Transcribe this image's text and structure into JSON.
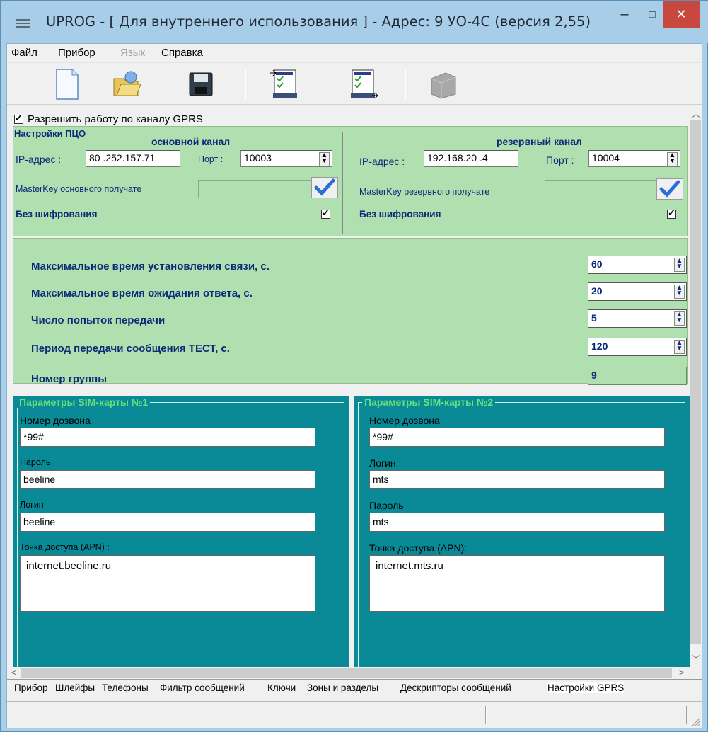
{
  "window": {
    "title": "UPROG - [ Для внутреннего использования ] - Адрес:  9  УО-4С (версия  2,55)",
    "min_glyph": "–",
    "max_glyph": "□",
    "close_glyph": "✕"
  },
  "menu": {
    "file": "Файл",
    "device": "Прибор",
    "language": "Язык",
    "help": "Справка"
  },
  "toolbar": {
    "icons": [
      "new-file-icon",
      "open-folder-icon",
      "save-disk-icon",
      "write-device-icon",
      "read-device-icon",
      "device-disabled-icon"
    ]
  },
  "gprs": {
    "enable_label": "Разрешить работу по каналу GPRS",
    "enabled": true
  },
  "pco": {
    "title": "Настройки ПЦО",
    "primary": {
      "title": "основной канал",
      "ip_label": "IP-адрес :",
      "ip_value": "80 .252.157.71",
      "port_label": "Порт :",
      "port_value": "10003",
      "masterkey_label": "MasterKey основного получате",
      "masterkey_value": "",
      "no_encryption_label": "Без шифрования",
      "no_encryption": true
    },
    "reserve": {
      "title": "резервный канал",
      "ip_label": "IP-адрес :",
      "ip_value": "192.168.20 .4",
      "port_label": "Порт :",
      "port_value": "10004",
      "masterkey_label": "MasterKey резервного получате",
      "masterkey_value": "",
      "no_encryption_label": "Без шифрования",
      "no_encryption": true
    }
  },
  "params": {
    "max_connect_label": "Максимальное время установления связи, с.",
    "max_connect_value": "60",
    "max_wait_label": "Максимальное время ожидания ответа, с.",
    "max_wait_value": "20",
    "attempts_label": "Число попыток передачи",
    "attempts_value": "5",
    "test_period_label": "Период передачи сообщения ТЕСТ, с.",
    "test_period_value": "120",
    "group_label": "Номер группы",
    "group_value": "9"
  },
  "sim1": {
    "title": "Параметры SIM-карты №1",
    "dial_label": "Номер дозвона",
    "dial_value": "*99#",
    "password_label": "Пароль",
    "password_value": "beeline",
    "login_label": "Логин",
    "login_value": "beeline",
    "apn_label": "Точка доступа (APN) :",
    "apn_value": "internet.beeline.ru"
  },
  "sim2": {
    "title": "Параметры SIM-карты №2",
    "dial_label": "Номер дозвона",
    "dial_value": "*99#",
    "login_label": "Логин",
    "login_value": "mts",
    "password_label": "Пароль",
    "password_value": "mts",
    "apn_label": "Точка доступа (APN):",
    "apn_value": "internet.mts.ru"
  },
  "tabs": [
    "Прибор",
    "Шлейфы",
    "Телефоны",
    "Фильтр сообщений",
    "Ключи",
    "Зоны и разделы",
    "Дескрипторы сообщений",
    "Настройки GPRS"
  ],
  "active_tab": "Настройки GPRS",
  "colors": {
    "green_panel": "#b0dfb0",
    "teal_panel": "#098a96",
    "label_blue": "#0b2a78",
    "sim_title_green": "#6ae07a",
    "close_red": "#c7483e"
  }
}
